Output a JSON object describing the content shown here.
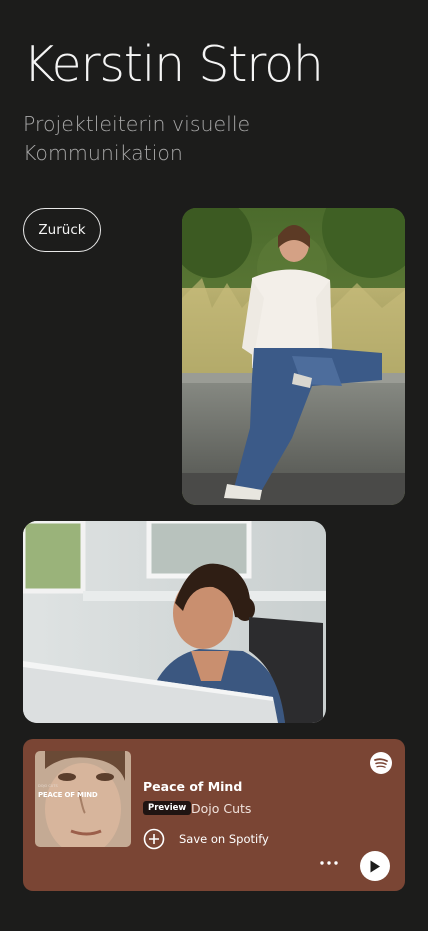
{
  "header": {
    "name": "Kerstin Stroh",
    "role": "Projektleiterin visuelle Kommunikation"
  },
  "nav": {
    "back_label": "Zurück"
  },
  "spotify_embed": {
    "track_title": "Peace of Mind",
    "badge": "Preview",
    "artist": "Dojo Cuts",
    "save_label": "Save on Spotify",
    "cover_text": "PEACE OF MIND",
    "cover_small_text": "DOJO CUTS",
    "more_icon": "more-horizontal-icon",
    "play_icon": "play-icon",
    "logo_icon": "spotify-logo-icon",
    "save_icon": "add-circle-icon",
    "background": "#7a4534"
  },
  "colors": {
    "page_bg": "#1c1c1b",
    "text": "#f4f4f4",
    "muted": "#a8a8a8"
  }
}
